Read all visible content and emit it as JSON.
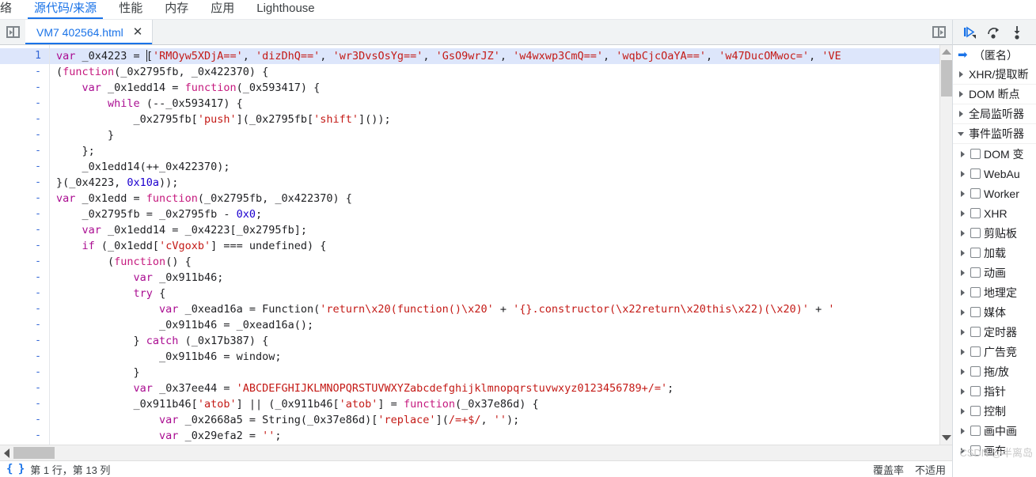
{
  "panel_tabs": [
    {
      "label": "络",
      "active": false
    },
    {
      "label": "源代码/来源",
      "active": true
    },
    {
      "label": "性能",
      "active": false
    },
    {
      "label": "内存",
      "active": false
    },
    {
      "label": "应用",
      "active": false
    },
    {
      "label": "Lighthouse",
      "active": false
    }
  ],
  "file_tab": {
    "title": "VM7 402564.html",
    "close_label": "✕",
    "navigator_toggle_name": "toggle-navigator",
    "sidebar_toggle_name": "toggle-debugger-sidebar"
  },
  "editor": {
    "line_number": "1",
    "wrap_marker": "-",
    "lines": [
      {
        "num": "1",
        "highlight": true,
        "caret_after": "var _0x4223 = ",
        "tokens": [
          {
            "t": "var ",
            "c": "k"
          },
          {
            "t": "_0x4223 ",
            "c": "p"
          },
          {
            "t": "= ",
            "c": "p"
          },
          {
            "t": "[",
            "c": "p"
          },
          {
            "t": "'RMOyw5XDjA=='",
            "c": "s"
          },
          {
            "t": ", ",
            "c": "p"
          },
          {
            "t": "'dizDhQ=='",
            "c": "s"
          },
          {
            "t": ", ",
            "c": "p"
          },
          {
            "t": "'wr3DvsOsYg=='",
            "c": "s"
          },
          {
            "t": ", ",
            "c": "p"
          },
          {
            "t": "'GsO9wrJZ'",
            "c": "s"
          },
          {
            "t": ", ",
            "c": "p"
          },
          {
            "t": "'w4wxwp3CmQ=='",
            "c": "s"
          },
          {
            "t": ", ",
            "c": "p"
          },
          {
            "t": "'wqbCjcOaYA=='",
            "c": "s"
          },
          {
            "t": ", ",
            "c": "p"
          },
          {
            "t": "'w47DucOMwoc='",
            "c": "s"
          },
          {
            "t": ", ",
            "c": "p"
          },
          {
            "t": "'VE",
            "c": "s"
          }
        ]
      },
      {
        "num": "-",
        "highlight": false,
        "tokens": [
          {
            "t": "(",
            "c": "p"
          },
          {
            "t": "function",
            "c": "fn"
          },
          {
            "t": "(_0x2795fb, _0x422370) {",
            "c": "p"
          }
        ]
      },
      {
        "num": "-",
        "highlight": false,
        "tokens": [
          {
            "t": "    ",
            "c": "p"
          },
          {
            "t": "var ",
            "c": "k"
          },
          {
            "t": "_0x1edd14 = ",
            "c": "p"
          },
          {
            "t": "function",
            "c": "fn"
          },
          {
            "t": "(_0x593417) {",
            "c": "p"
          }
        ]
      },
      {
        "num": "-",
        "highlight": false,
        "tokens": [
          {
            "t": "        ",
            "c": "p"
          },
          {
            "t": "while ",
            "c": "k"
          },
          {
            "t": "(--_0x593417) {",
            "c": "p"
          }
        ]
      },
      {
        "num": "-",
        "highlight": false,
        "tokens": [
          {
            "t": "            _0x2795fb[",
            "c": "p"
          },
          {
            "t": "'push'",
            "c": "s"
          },
          {
            "t": "](_0x2795fb[",
            "c": "p"
          },
          {
            "t": "'shift'",
            "c": "s"
          },
          {
            "t": "]());",
            "c": "p"
          }
        ]
      },
      {
        "num": "-",
        "highlight": false,
        "tokens": [
          {
            "t": "        }",
            "c": "p"
          }
        ]
      },
      {
        "num": "-",
        "highlight": false,
        "tokens": [
          {
            "t": "    };",
            "c": "p"
          }
        ]
      },
      {
        "num": "-",
        "highlight": false,
        "tokens": [
          {
            "t": "    _0x1edd14(++_0x422370);",
            "c": "p"
          }
        ]
      },
      {
        "num": "-",
        "highlight": false,
        "tokens": [
          {
            "t": "}(_0x4223, ",
            "c": "p"
          },
          {
            "t": "0x10a",
            "c": "n"
          },
          {
            "t": "));",
            "c": "p"
          }
        ]
      },
      {
        "num": "-",
        "highlight": false,
        "tokens": [
          {
            "t": "var ",
            "c": "k"
          },
          {
            "t": "_0x1edd = ",
            "c": "p"
          },
          {
            "t": "function",
            "c": "fn"
          },
          {
            "t": "(_0x2795fb, _0x422370) {",
            "c": "p"
          }
        ]
      },
      {
        "num": "-",
        "highlight": false,
        "tokens": [
          {
            "t": "    _0x2795fb = _0x2795fb - ",
            "c": "p"
          },
          {
            "t": "0x0",
            "c": "n"
          },
          {
            "t": ";",
            "c": "p"
          }
        ]
      },
      {
        "num": "-",
        "highlight": false,
        "tokens": [
          {
            "t": "    ",
            "c": "p"
          },
          {
            "t": "var ",
            "c": "k"
          },
          {
            "t": "_0x1edd14 = _0x4223[_0x2795fb];",
            "c": "p"
          }
        ]
      },
      {
        "num": "-",
        "highlight": false,
        "tokens": [
          {
            "t": "    ",
            "c": "p"
          },
          {
            "t": "if ",
            "c": "k"
          },
          {
            "t": "(_0x1edd[",
            "c": "p"
          },
          {
            "t": "'cVgoxb'",
            "c": "s"
          },
          {
            "t": "] === undefined) {",
            "c": "p"
          }
        ]
      },
      {
        "num": "-",
        "highlight": false,
        "tokens": [
          {
            "t": "        (",
            "c": "p"
          },
          {
            "t": "function",
            "c": "fn"
          },
          {
            "t": "() {",
            "c": "p"
          }
        ]
      },
      {
        "num": "-",
        "highlight": false,
        "tokens": [
          {
            "t": "            ",
            "c": "p"
          },
          {
            "t": "var ",
            "c": "k"
          },
          {
            "t": "_0x911b46;",
            "c": "p"
          }
        ]
      },
      {
        "num": "-",
        "highlight": false,
        "tokens": [
          {
            "t": "            ",
            "c": "p"
          },
          {
            "t": "try ",
            "c": "k"
          },
          {
            "t": "{",
            "c": "p"
          }
        ]
      },
      {
        "num": "-",
        "highlight": false,
        "tokens": [
          {
            "t": "                ",
            "c": "p"
          },
          {
            "t": "var ",
            "c": "k"
          },
          {
            "t": "_0xead16a = Function(",
            "c": "p"
          },
          {
            "t": "'return\\x20(function()\\x20'",
            "c": "s"
          },
          {
            "t": " + ",
            "c": "p"
          },
          {
            "t": "'{}.constructor(\\x22return\\x20this\\x22)(\\x20)'",
            "c": "s"
          },
          {
            "t": " + ",
            "c": "p"
          },
          {
            "t": "'",
            "c": "s"
          }
        ]
      },
      {
        "num": "-",
        "highlight": false,
        "tokens": [
          {
            "t": "                _0x911b46 = _0xead16a();",
            "c": "p"
          }
        ]
      },
      {
        "num": "-",
        "highlight": false,
        "tokens": [
          {
            "t": "            } ",
            "c": "p"
          },
          {
            "t": "catch ",
            "c": "k"
          },
          {
            "t": "(_0x17b387) {",
            "c": "p"
          }
        ]
      },
      {
        "num": "-",
        "highlight": false,
        "tokens": [
          {
            "t": "                _0x911b46 = window;",
            "c": "p"
          }
        ]
      },
      {
        "num": "-",
        "highlight": false,
        "tokens": [
          {
            "t": "            }",
            "c": "p"
          }
        ]
      },
      {
        "num": "-",
        "highlight": false,
        "tokens": [
          {
            "t": "            ",
            "c": "p"
          },
          {
            "t": "var ",
            "c": "k"
          },
          {
            "t": "_0x37ee44 = ",
            "c": "p"
          },
          {
            "t": "'ABCDEFGHIJKLMNOPQRSTUVWXYZabcdefghijklmnopqrstuvwxyz0123456789+/='",
            "c": "s"
          },
          {
            "t": ";",
            "c": "p"
          }
        ]
      },
      {
        "num": "-",
        "highlight": false,
        "tokens": [
          {
            "t": "            _0x911b46[",
            "c": "p"
          },
          {
            "t": "'atob'",
            "c": "s"
          },
          {
            "t": "] || (_0x911b46[",
            "c": "p"
          },
          {
            "t": "'atob'",
            "c": "s"
          },
          {
            "t": "] = ",
            "c": "p"
          },
          {
            "t": "function",
            "c": "fn"
          },
          {
            "t": "(_0x37e86d) {",
            "c": "p"
          }
        ]
      },
      {
        "num": "-",
        "highlight": false,
        "tokens": [
          {
            "t": "                ",
            "c": "p"
          },
          {
            "t": "var ",
            "c": "k"
          },
          {
            "t": "_0x2668a5 = String(_0x37e86d)[",
            "c": "p"
          },
          {
            "t": "'replace'",
            "c": "s"
          },
          {
            "t": "](",
            "c": "p"
          },
          {
            "t": "/=+$/",
            "c": "s"
          },
          {
            "t": ", ",
            "c": "p"
          },
          {
            "t": "''",
            "c": "s"
          },
          {
            "t": ");",
            "c": "p"
          }
        ]
      },
      {
        "num": "-",
        "highlight": false,
        "tokens": [
          {
            "t": "                ",
            "c": "p"
          },
          {
            "t": "var ",
            "c": "k"
          },
          {
            "t": "_0x29efa2 = ",
            "c": "p"
          },
          {
            "t": "''",
            "c": "s"
          },
          {
            "t": ";",
            "c": "p"
          }
        ]
      }
    ]
  },
  "statusbar": {
    "pretty_print_icon": "{ }",
    "position_text": "第 1 行，第 13 列",
    "right_items": [
      "覆盖率",
      "不适用"
    ]
  },
  "debugger_toolbar": [
    {
      "name": "resume-script-execution-icon",
      "glyph": "resume"
    },
    {
      "name": "step-over-icon",
      "glyph": "step-over"
    },
    {
      "name": "step-into-icon",
      "glyph": "step-into"
    }
  ],
  "sidebar": {
    "call_frame": "（匿名）",
    "sections": [
      {
        "label": "XHR/提取断",
        "expanded": false
      },
      {
        "label": "DOM 断点",
        "expanded": false
      },
      {
        "label": "全局监听器",
        "expanded": false
      },
      {
        "label": "事件监听器",
        "expanded": true
      }
    ],
    "event_categories": [
      "DOM 变",
      "WebAu",
      "Worker",
      "XHR",
      "剪贴板",
      "加载",
      "动画",
      "地理定",
      "媒体",
      "定时器",
      "广告竞",
      "拖/放",
      "指针",
      "控制",
      "画中画",
      "画布"
    ]
  },
  "watermark": "CSDN @半离岛"
}
